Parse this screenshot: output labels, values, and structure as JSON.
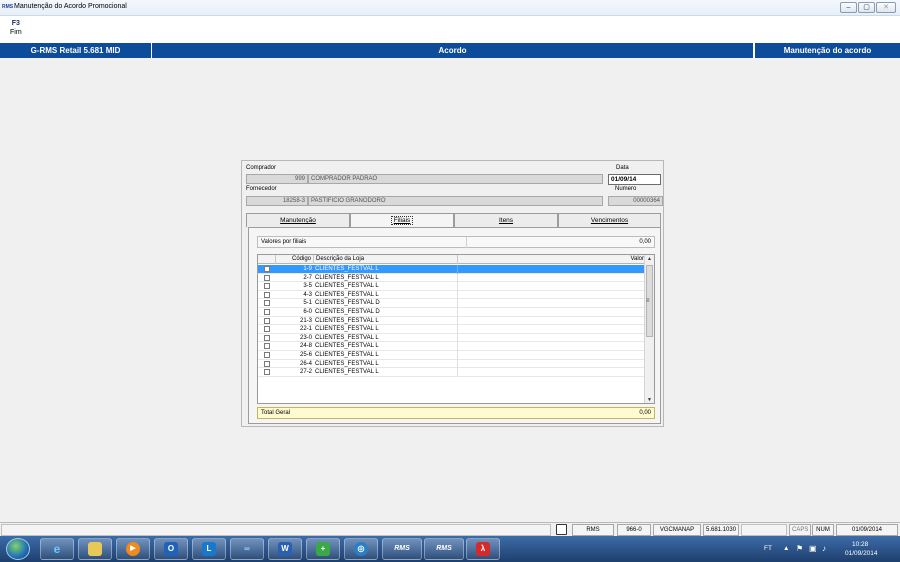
{
  "window": {
    "title": "Manutenção do Acordo Promocional",
    "icon_text": "RMS"
  },
  "fkeys": [
    {
      "key": "F3",
      "label": "Fim"
    }
  ],
  "header": {
    "left": "G-RMS Retail 5.681 MID",
    "center": "Acordo",
    "right": "Manutenção do acordo"
  },
  "form": {
    "comprador_label": "Comprador",
    "comprador_code": "999",
    "comprador_name": "COMPRADOR PADRAO",
    "data_label": "Data",
    "data_value": "01/09/14",
    "fornecedor_label": "Fornecedor",
    "fornecedor_code": "18258-3",
    "fornecedor_name": "PASTIFICIO GRANODORO",
    "numero_label": "Numero",
    "numero_value": "00000364"
  },
  "tabs": [
    {
      "label": "Manutenção",
      "active": false
    },
    {
      "label": "Filiais",
      "active": true
    },
    {
      "label": "Itens",
      "active": false
    },
    {
      "label": "Vencimentos",
      "active": false
    }
  ],
  "summary": {
    "label": "Valores por filiais",
    "value": "0,00"
  },
  "grid": {
    "columns": [
      "Código",
      "Descrição da Loja",
      "Valor"
    ],
    "rows": [
      {
        "code": "1-9",
        "desc": "CLIENTES_FESTVAL L",
        "selected": true
      },
      {
        "code": "2-7",
        "desc": "CLIENTES_FESTVAL L",
        "selected": false
      },
      {
        "code": "3-5",
        "desc": "CLIENTES_FESTVAL L",
        "selected": false
      },
      {
        "code": "4-3",
        "desc": "CLIENTES_FESTVAL L",
        "selected": false
      },
      {
        "code": "5-1",
        "desc": "CLIENTES_FESTVAL D",
        "selected": false
      },
      {
        "code": "6-0",
        "desc": "CLIENTES_FESTVAL D",
        "selected": false
      },
      {
        "code": "21-3",
        "desc": "CLIENTES_FESTVAL L",
        "selected": false
      },
      {
        "code": "22-1",
        "desc": "CLIENTES_FESTVAL L",
        "selected": false
      },
      {
        "code": "23-0",
        "desc": "CLIENTES_FESTVAL L",
        "selected": false
      },
      {
        "code": "24-8",
        "desc": "CLIENTES_FESTVAL L",
        "selected": false
      },
      {
        "code": "25-6",
        "desc": "CLIENTES_FESTVAL L",
        "selected": false
      },
      {
        "code": "26-4",
        "desc": "CLIENTES_FESTVAL L",
        "selected": false
      },
      {
        "code": "27-2",
        "desc": "CLIENTES_FESTVAL L",
        "selected": false
      }
    ],
    "scroll_mid_glyph": "≡"
  },
  "total": {
    "label": "Total Geral",
    "value": "0,00"
  },
  "statusbar": {
    "items": [
      "RMS",
      "966-0",
      "VGCMANAP",
      "5.681.1030",
      "",
      "CAPS",
      "NUM",
      "01/09/2014"
    ]
  },
  "taskbar": {
    "apps": [
      "ie-icon",
      "explorer-icon",
      "media-player-icon",
      "outlook-icon",
      "lync-icon",
      "app-icon",
      "word-icon",
      "installer-icon",
      "app-icon-2",
      "rms-app-1",
      "rms-app-2",
      "pdf-icon"
    ],
    "rms_label": "RMS",
    "tray_text": "FT",
    "time": "10:28",
    "date": "01/09/2014"
  },
  "colors": {
    "header_blue": "#0d4b9b",
    "selection_blue": "#3399ff",
    "total_yellow": "#fffbd0",
    "taskbar_blue": "#2a5590"
  }
}
